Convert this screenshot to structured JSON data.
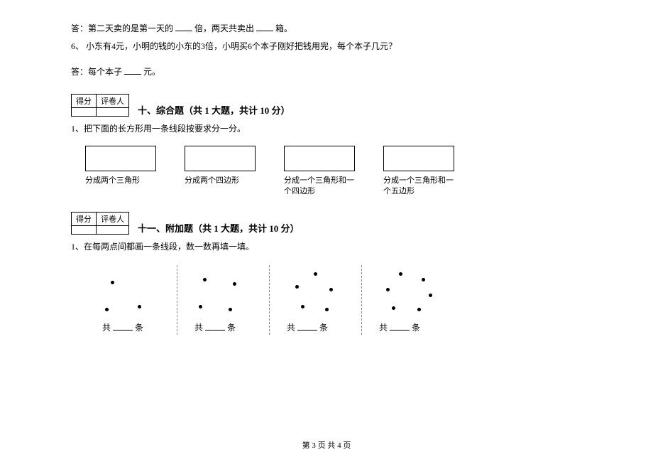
{
  "q5_answer": {
    "prefix": "答：第二天卖的是第一天的",
    "mid": "倍，两天共卖出",
    "suffix": "箱。"
  },
  "q6": {
    "number": "6、",
    "text": "小东有4元，小明的钱的小东的3倍，小明买6个本子刚好把钱用完，每个本子几元？",
    "answer_prefix": "答：每个本子",
    "answer_suffix": "元。"
  },
  "score_table": {
    "col1": "得分",
    "col2": "评卷人"
  },
  "section10": {
    "title": "十、综合题（共 1 大题，共计 10 分）",
    "q1": "1、把下面的长方形用一条线段按要求分一分。",
    "labels": [
      "分成两个三角形",
      "分成两个四边形",
      "分成一个三角形和一个四边形",
      "分成一个三角形和一个五边形"
    ]
  },
  "section11": {
    "title": "十一、附加题（共 1 大题，共计 10 分）",
    "q1": "1、在每两点间都画一条线段，数一数再填一填。",
    "count_prefix": "共",
    "count_suffix": "条"
  },
  "footer": "第 3 页 共 4 页"
}
